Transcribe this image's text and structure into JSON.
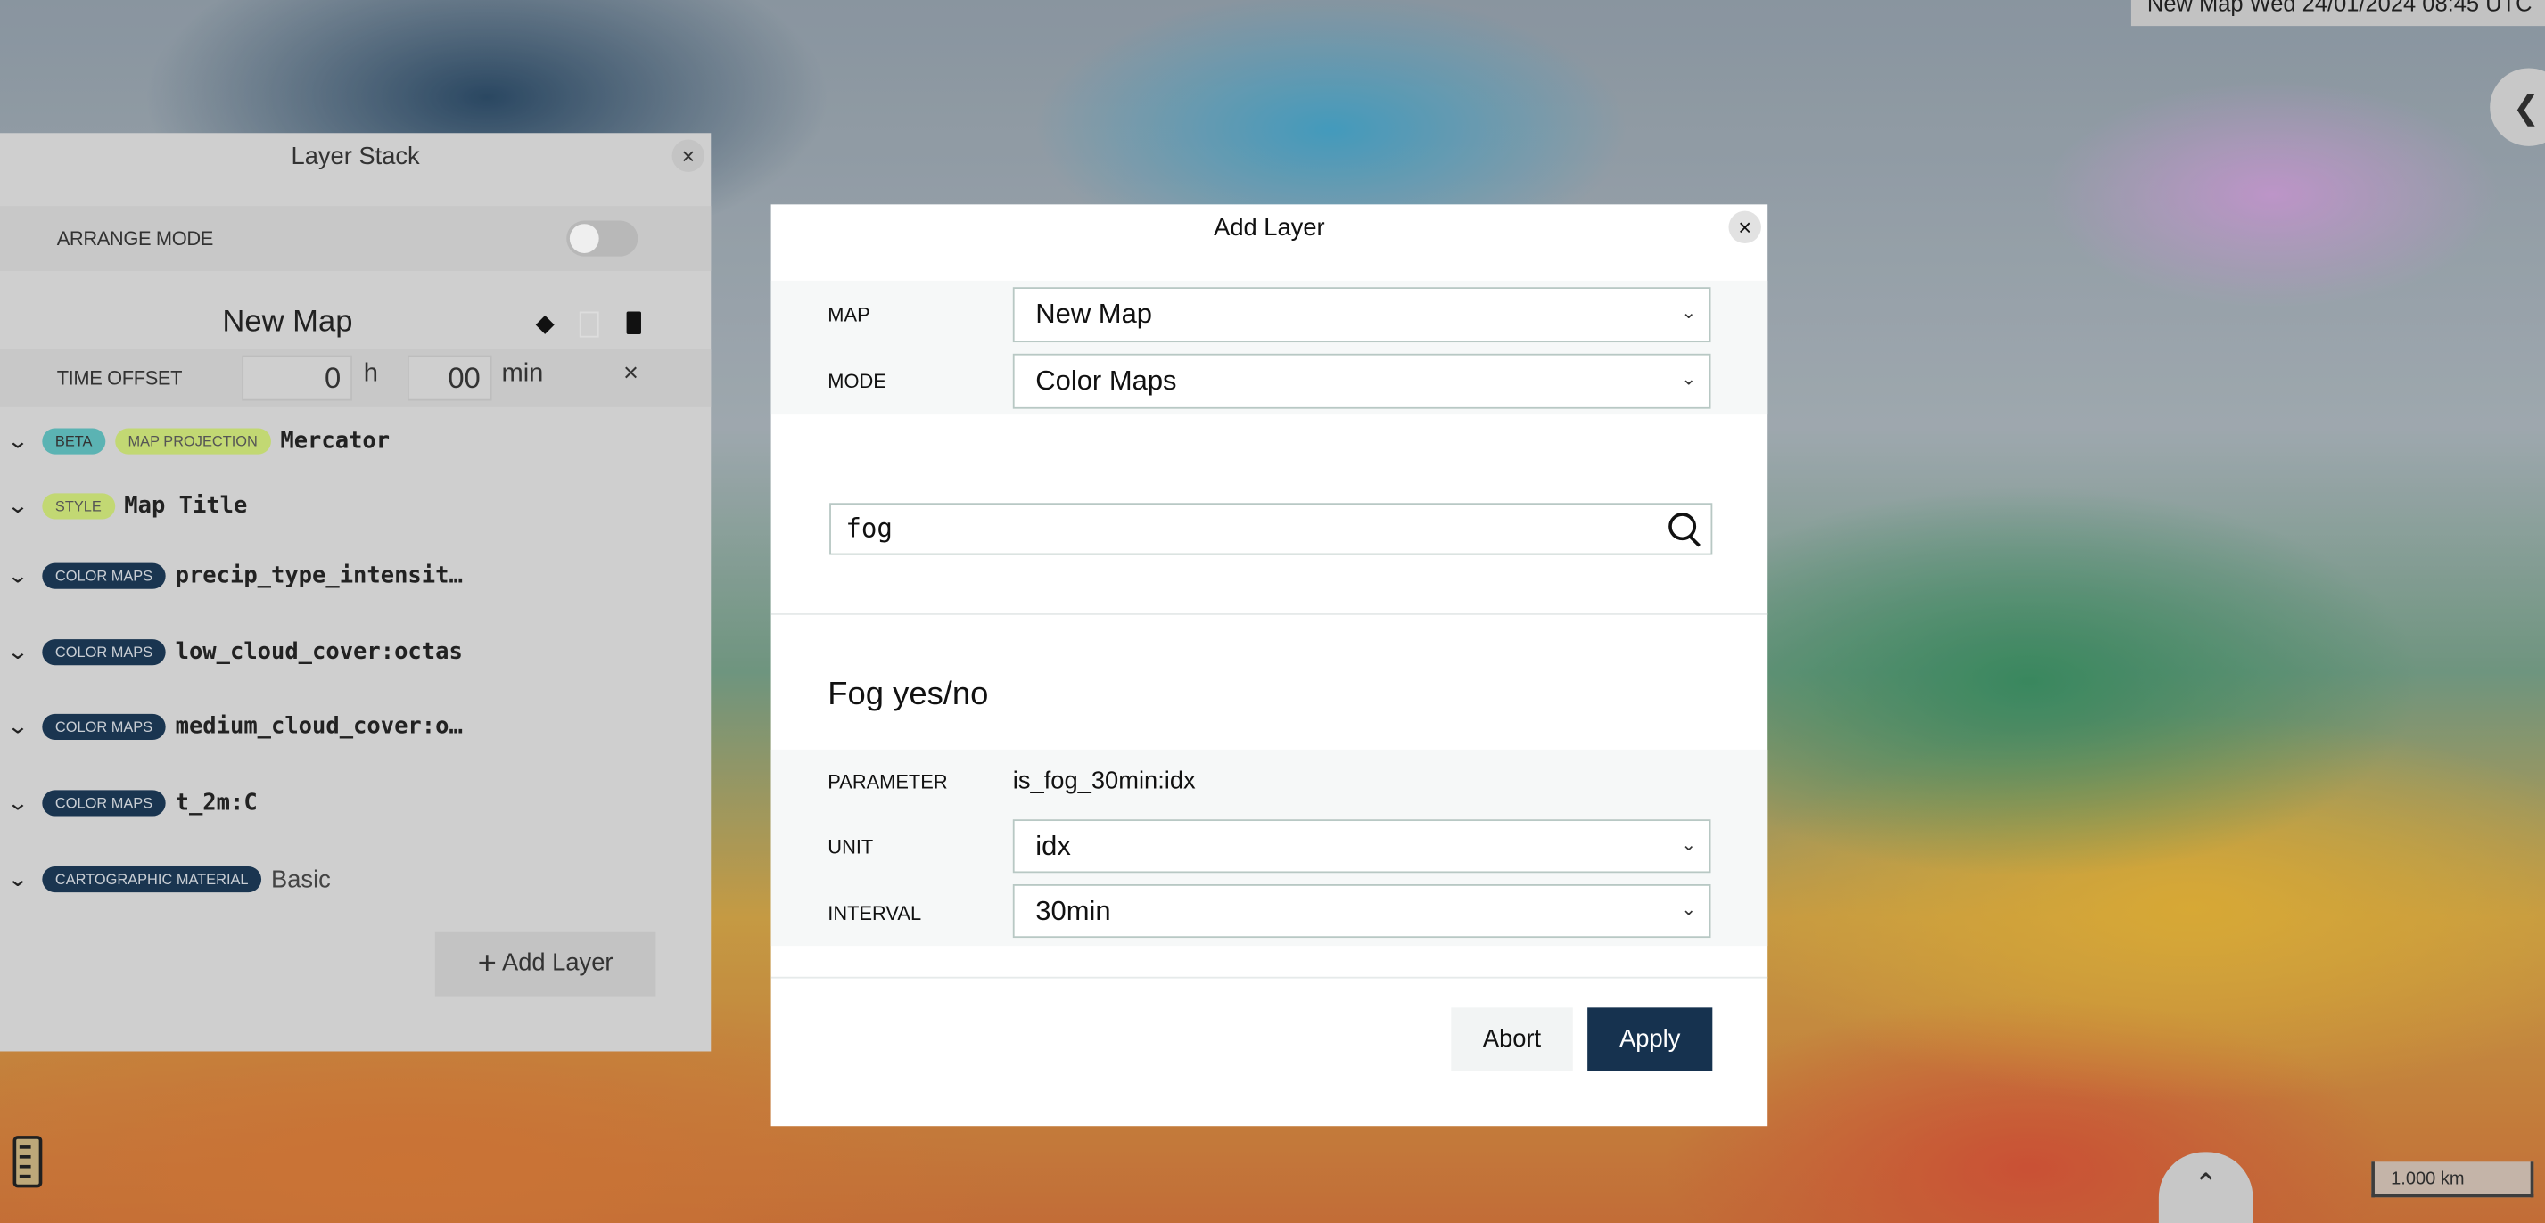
{
  "map": {
    "timestamp": "New Map Wed  24/01/2024  08:45 UTC",
    "scale_label": "1.000 km",
    "collapse_icon": "chevron-left-icon",
    "expand_icon": "chevron-up-icon",
    "ruler_icon": "ruler-icon"
  },
  "layer_stack": {
    "title": "Layer Stack",
    "close": "×",
    "arrange_mode_label": "ARRANGE MODE",
    "arrange_mode_on": false,
    "map_name": "New Map",
    "time_offset_label": "TIME OFFSET",
    "hours": "0",
    "hours_unit": "h",
    "minutes": "00",
    "minutes_unit": "min",
    "clear": "×",
    "layers": [
      {
        "tags": [
          "BETA",
          "MAP PROJECTION"
        ],
        "name": "Mercator"
      },
      {
        "tags": [
          "STYLE"
        ],
        "name": "Map Title"
      },
      {
        "tags": [
          "COLOR MAPS"
        ],
        "name": "precip_type_intensit…"
      },
      {
        "tags": [
          "COLOR MAPS"
        ],
        "name": "low_cloud_cover:octas"
      },
      {
        "tags": [
          "COLOR MAPS"
        ],
        "name": "medium_cloud_cover:o…"
      },
      {
        "tags": [
          "COLOR MAPS"
        ],
        "name": "t_2m:C"
      },
      {
        "tags": [
          "CARTOGRAPHIC MATERIAL"
        ],
        "name": "Basic"
      }
    ],
    "add_layer": "Add Layer"
  },
  "dialog": {
    "title": "Add Layer",
    "close": "×",
    "map_label": "MAP",
    "map_value": "New Map",
    "mode_label": "MODE",
    "mode_value": "Color Maps",
    "search_value": "fog",
    "result_title": "Fog yes/no",
    "parameter_label": "PARAMETER",
    "parameter_value": "is_fog_30min:idx",
    "unit_label": "UNIT",
    "unit_value": "idx",
    "interval_label": "INTERVAL",
    "interval_value": "30min",
    "abort": "Abort",
    "apply": "Apply"
  },
  "colors": {
    "primary": "#16324f",
    "badge_beta": "#5bb3b3",
    "badge_green": "#c2d873"
  }
}
